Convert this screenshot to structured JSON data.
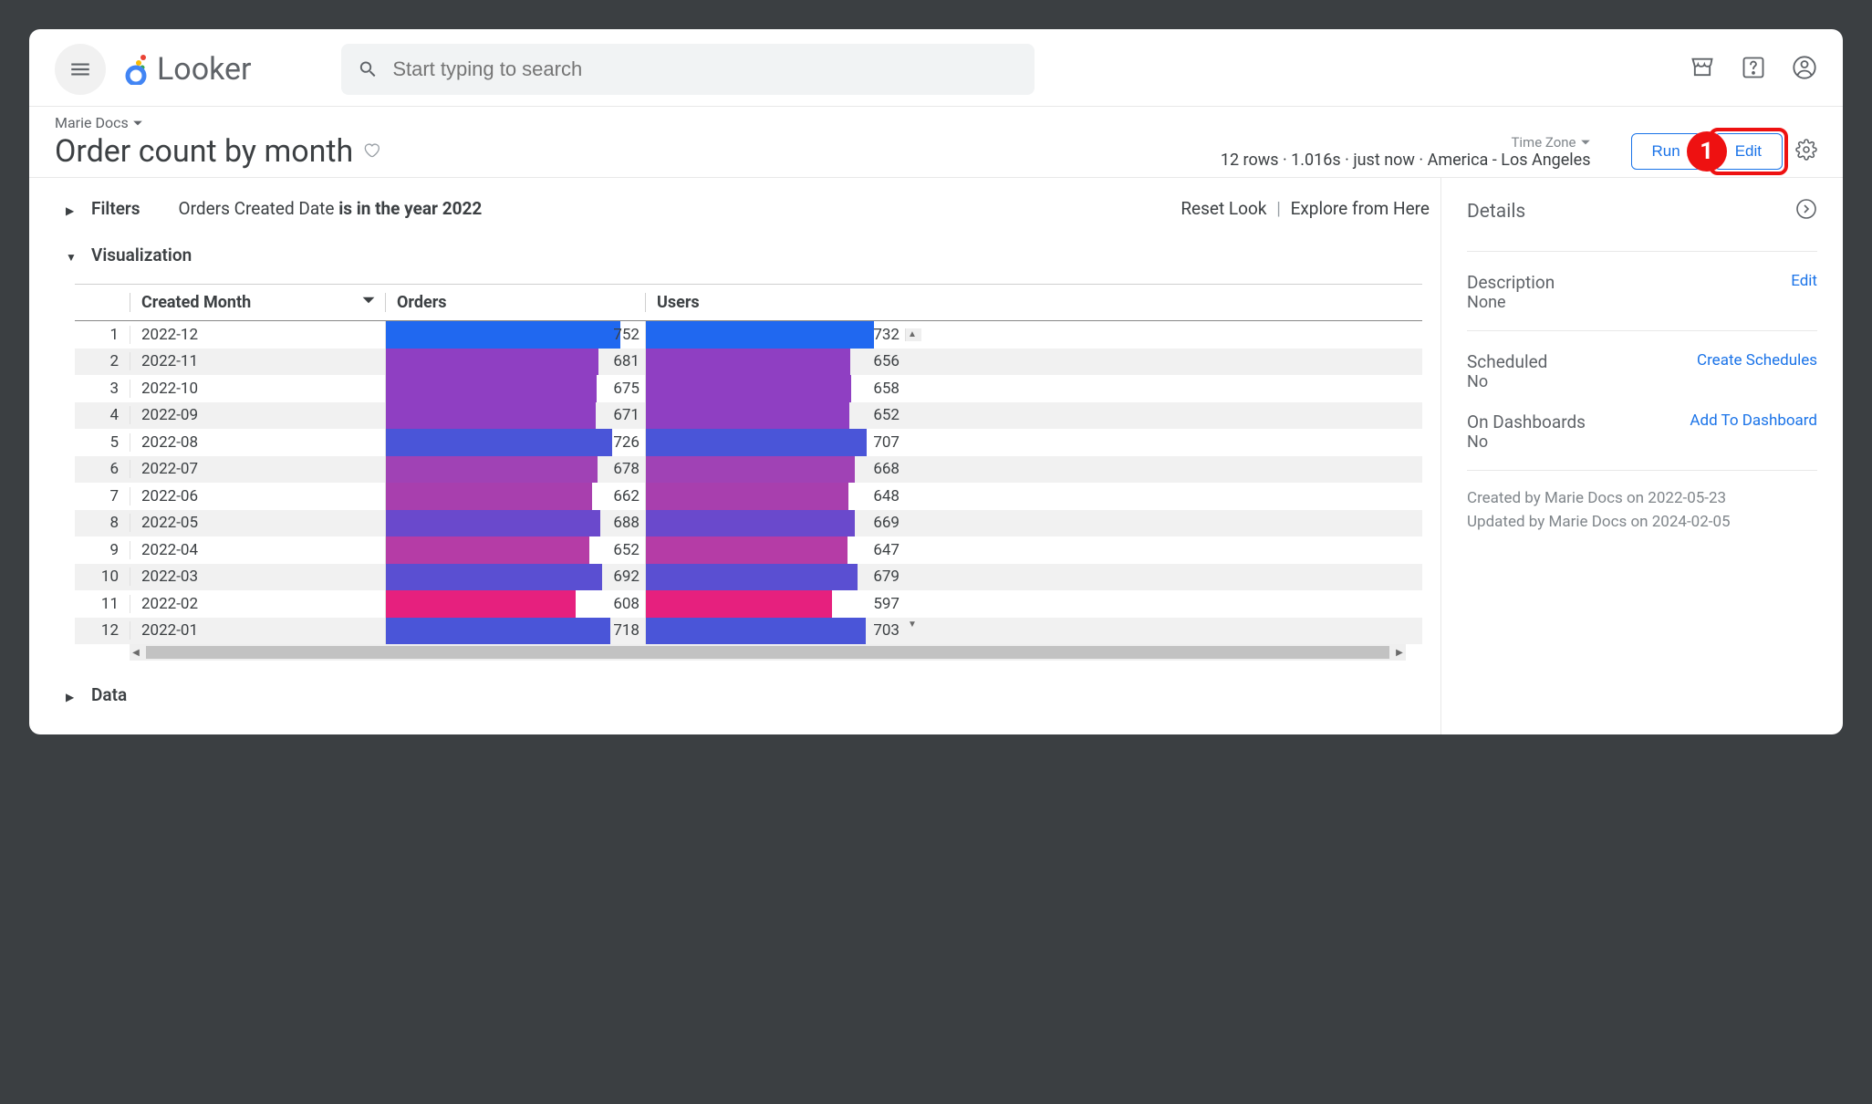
{
  "brand": "Looker",
  "search": {
    "placeholder": "Start typing to search"
  },
  "breadcrumb": "Marie Docs",
  "title": "Order count by month",
  "timezone_label": "Time Zone",
  "status": {
    "rows": "12 rows",
    "elapsed": "1.016s",
    "when": "just now",
    "tz": "America - Los Angeles"
  },
  "buttons": {
    "run": "Run",
    "edit": "Edit"
  },
  "callout": "1",
  "filters": {
    "label": "Filters",
    "text_plain": "Orders Created Date ",
    "text_bold": "is in the year 2022",
    "reset": "Reset Look",
    "explore": "Explore from Here"
  },
  "viz": {
    "label": "Visualization"
  },
  "data_label": "Data",
  "columns": {
    "idx": "",
    "month": "Created Month",
    "orders": "Orders",
    "users": "Users"
  },
  "side": {
    "title": "Details",
    "description": {
      "label": "Description",
      "value": "None",
      "link": "Edit"
    },
    "scheduled": {
      "label": "Scheduled",
      "value": "No",
      "link": "Create Schedules"
    },
    "dashboards": {
      "label": "On Dashboards",
      "value": "No",
      "link": "Add To Dashboard"
    },
    "created": "Created by Marie Docs on 2022-05-23",
    "updated": "Updated by Marie Docs on 2024-02-05"
  },
  "chart_data": {
    "type": "bar",
    "title": "Order count by month",
    "categories": [
      "2022-12",
      "2022-11",
      "2022-10",
      "2022-09",
      "2022-08",
      "2022-07",
      "2022-06",
      "2022-05",
      "2022-04",
      "2022-03",
      "2022-02",
      "2022-01"
    ],
    "series": [
      {
        "name": "Orders",
        "values": [
          752,
          681,
          675,
          671,
          726,
          678,
          662,
          688,
          652,
          692,
          608,
          718
        ]
      },
      {
        "name": "Users",
        "values": [
          732,
          656,
          658,
          652,
          707,
          668,
          648,
          669,
          647,
          679,
          597,
          703
        ]
      }
    ],
    "colors": [
      "#2068f0",
      "#8f3fc2",
      "#8f3fc2",
      "#8f3fc2",
      "#4a55d8",
      "#a042b5",
      "#a83fae",
      "#6a49cc",
      "#b53ca6",
      "#5a4fd2",
      "#e6207e",
      "#4a55d8"
    ],
    "xlim": [
      0,
      760
    ]
  }
}
